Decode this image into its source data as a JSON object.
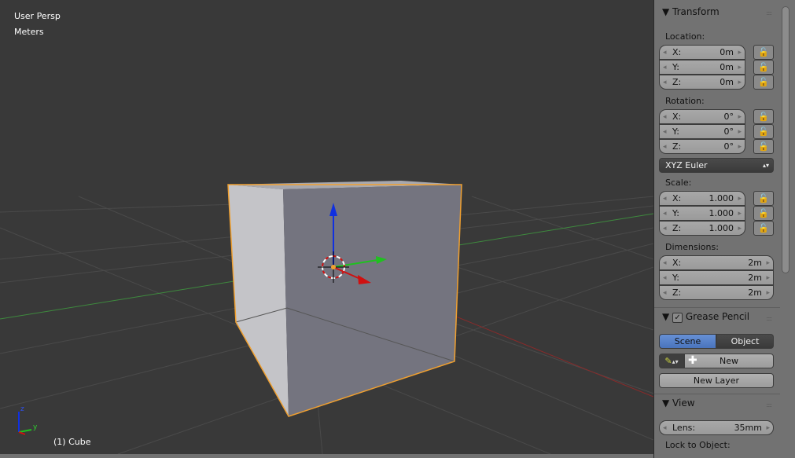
{
  "viewport": {
    "view_name": "User Persp",
    "units": "Meters",
    "object_label": "(1) Cube",
    "axis_labels": {
      "z": "z",
      "y": "y"
    }
  },
  "colors": {
    "x_axis": "#d01010",
    "y_axis": "#20c020",
    "z_axis": "#1030e0",
    "selection": "#f0a030",
    "panel_bg": "#727272",
    "active_tab": "#5680c2"
  },
  "panel": {
    "transform": {
      "title": "Transform",
      "location": {
        "label": "Location:",
        "x": {
          "label": "X:",
          "value": "0m"
        },
        "y": {
          "label": "Y:",
          "value": "0m"
        },
        "z": {
          "label": "Z:",
          "value": "0m"
        }
      },
      "rotation": {
        "label": "Rotation:",
        "x": {
          "label": "X:",
          "value": "0°"
        },
        "y": {
          "label": "Y:",
          "value": "0°"
        },
        "z": {
          "label": "Z:",
          "value": "0°"
        }
      },
      "rotation_mode": "XYZ Euler",
      "scale": {
        "label": "Scale:",
        "x": {
          "label": "X:",
          "value": "1.000"
        },
        "y": {
          "label": "Y:",
          "value": "1.000"
        },
        "z": {
          "label": "Z:",
          "value": "1.000"
        }
      },
      "dimensions": {
        "label": "Dimensions:",
        "x": {
          "label": "X:",
          "value": "2m"
        },
        "y": {
          "label": "Y:",
          "value": "2m"
        },
        "z": {
          "label": "Z:",
          "value": "2m"
        }
      }
    },
    "grease_pencil": {
      "title": "Grease Pencil",
      "enabled": true,
      "tab_scene": "Scene",
      "tab_object": "Object",
      "new": "New",
      "new_layer": "New Layer"
    },
    "view": {
      "title": "View",
      "lens_label": "Lens:",
      "lens_value": "35mm",
      "lock_label": "Lock to Object:"
    }
  }
}
